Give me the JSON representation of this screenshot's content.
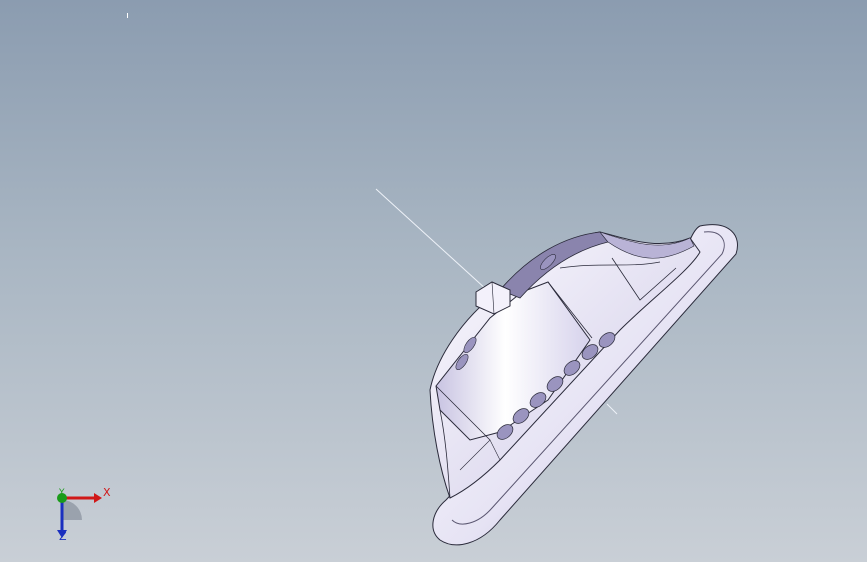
{
  "viewport": {
    "background_top": "#8b9cb0",
    "background_bottom": "#c9cfd6"
  },
  "model": {
    "body_fill": "#f4f2fb",
    "shade_fill": "#b9b3d6",
    "edge_color": "#2a2a3a"
  },
  "triad": {
    "x_label": "X",
    "y_label": "Y",
    "z_label": "Z",
    "x_color": "#d01818",
    "y_color": "#1a9b1a",
    "z_color": "#1a2fbf"
  }
}
